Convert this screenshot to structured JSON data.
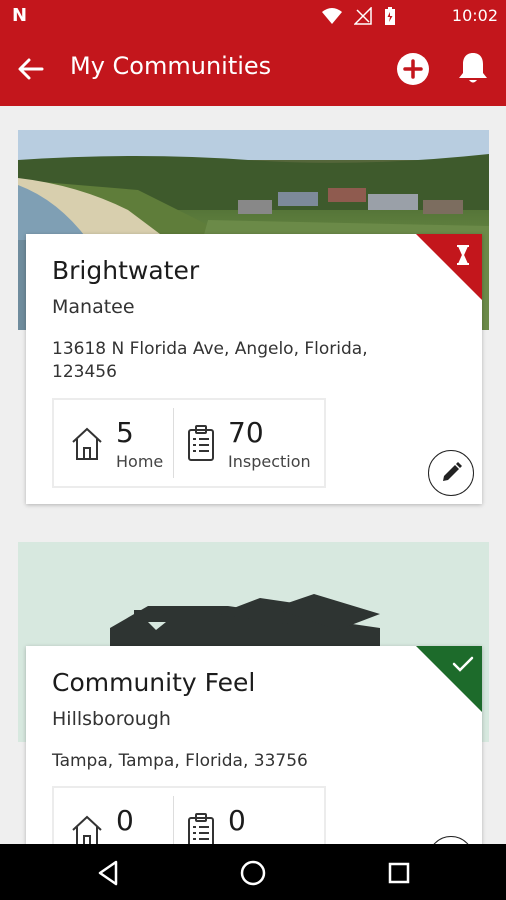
{
  "status_bar": {
    "carrier_glyph": "N",
    "time": "10:02",
    "icons": [
      "wifi-icon",
      "no-signal-icon",
      "battery-icon"
    ]
  },
  "app_bar": {
    "title": "My Communities",
    "back_icon": "arrow-left-icon",
    "add_icon": "add-circle-icon",
    "notification_icon": "bell-icon"
  },
  "communities": [
    {
      "name": "Brightwater",
      "county": "Manatee",
      "address": "13618 N Florida Ave, Angelo, Florida, 123456",
      "homes": "5",
      "homes_label": "Home",
      "inspections": "70",
      "inspections_label": "Inspection",
      "status_icon": "hourglass-icon",
      "status_color": "#c3161c"
    },
    {
      "name": "Community Feel",
      "county": "Hillsborough",
      "address": "Tampa, Tampa, Florida, 33756",
      "homes": "0",
      "inspections": "0",
      "status_icon": "checkmark-icon",
      "status_color": "#1d6b2b"
    }
  ],
  "colors": {
    "brand_red": "#c3161c",
    "success_green": "#1d6b2b",
    "placeholder_mint": "#d7e8df"
  }
}
